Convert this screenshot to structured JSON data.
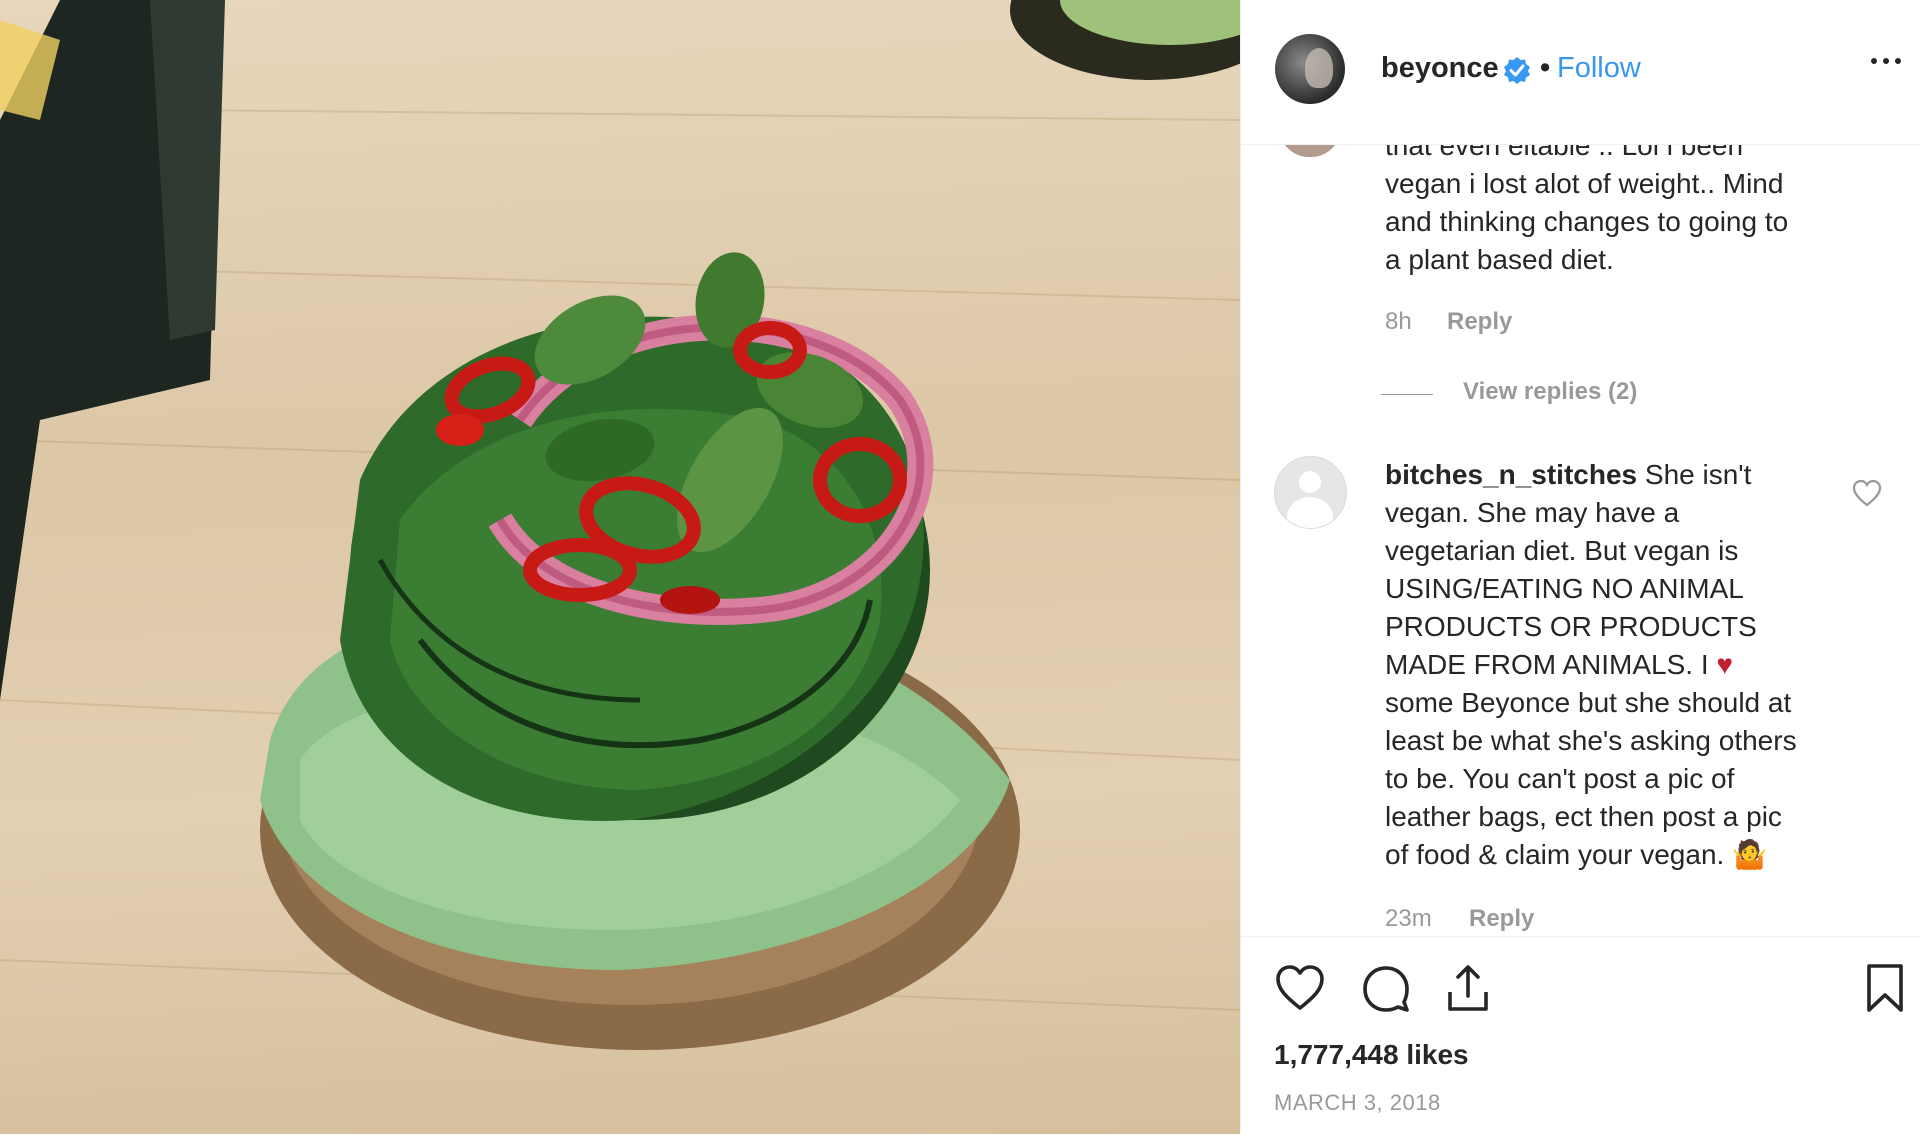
{
  "post": {
    "username": "beyonce",
    "follow_label": "Follow",
    "separator": "•",
    "likes": "1,777,448 likes",
    "date": "MARCH 3, 2018"
  },
  "comments": [
    {
      "text_lines": [
        "that even eitable .. Lol i been",
        "vegan i lost alot of weight.. Mind",
        "and thinking changes to going to",
        "a plant based diet."
      ],
      "time": "8h",
      "reply_label": "Reply",
      "view_replies": "View replies (2)"
    },
    {
      "user": "bitches_n_stitches",
      "first_line": " She isn't",
      "lines": [
        "vegan. She may have a",
        "vegetarian diet. But vegan is",
        "USING/EATING NO ANIMAL",
        "PRODUCTS OR PRODUCTS",
        "MADE FROM ANIMALS. I",
        "some Beyonce but she should at",
        "least be what she's asking others",
        "to be. You can't post a pic of",
        "leather bags, ect then post a pic",
        "of food & claim your vegan."
      ],
      "heart_emoji": "♥",
      "shrug_emoji": "🤷",
      "time": "23m",
      "reply_label": "Reply"
    }
  ],
  "icons": {
    "verified": "verified-badge-icon",
    "more": "more-options-icon",
    "like": "heart-icon",
    "comment": "comment-icon",
    "share": "share-icon",
    "save": "bookmark-icon"
  },
  "colors": {
    "link": "#3897f0",
    "verified": "#3897f0",
    "muted": "#999999",
    "emoji_heart": "#c0202f"
  }
}
